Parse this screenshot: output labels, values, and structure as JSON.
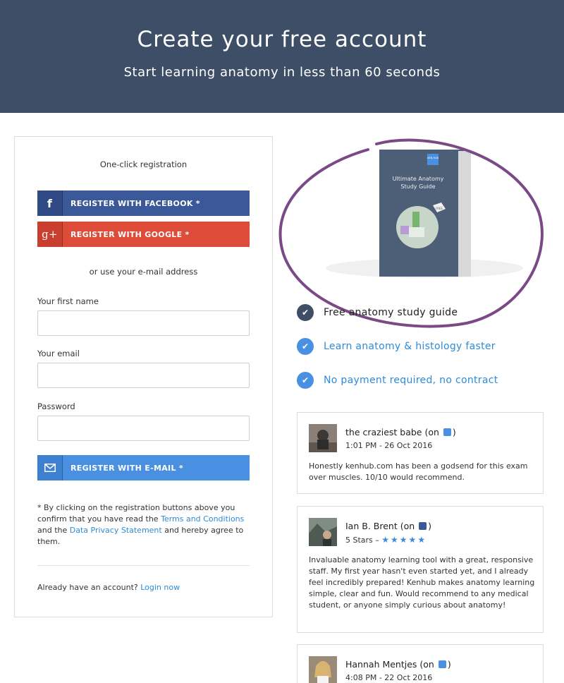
{
  "header": {
    "title": "Create your free account",
    "subtitle": "Start learning anatomy in less than 60 seconds"
  },
  "form": {
    "one_click_label": "One-click registration",
    "facebook_button": "REGISTER WITH FACEBOOK *",
    "google_button": "REGISTER WITH GOOGLE *",
    "or_use_label": "or use your e-mail address",
    "first_name_label": "Your first name",
    "first_name_value": "",
    "email_label": "Your email",
    "email_value": "",
    "password_label": "Password",
    "password_value": "",
    "email_button": "REGISTER WITH E-MAIL *",
    "legal_prefix": "* By clicking on the registration buttons above you confirm that you have read the ",
    "terms_link": "Terms and Conditions",
    "legal_and": " and the ",
    "privacy_link": "Data Privacy Statement",
    "legal_suffix": " and hereby agree to them.",
    "already_text": "Already have an account? ",
    "login_link": "Login now"
  },
  "guide": {
    "book_title_line1": "Ultimate Anatomy",
    "book_title_line2": "Study Guide",
    "brand": "KEN HUB",
    "badge": "FREE"
  },
  "benefits": [
    "Free anatomy study guide",
    "Learn anatomy & histology faster",
    "No payment required, no contract"
  ],
  "reviews": [
    {
      "name": "the craziest babe (on",
      "name_suffix": ")",
      "meta": "1:01 PM - 26 Oct 2016",
      "text": "Honestly kenhub.com has been a godsend for this exam over muscles. 10/10 would recommend."
    },
    {
      "name": "Ian B. Brent (on",
      "name_suffix": ")",
      "meta": "5 Stars – ",
      "rating": 5,
      "stars": "★★★★★",
      "text": "Invaluable anatomy learning tool with a great, responsive staff. My first year hasn't even started yet, and I already feel incredibly prepared! Kenhub makes anatomy learning simple, clear and fun. Would recommend to any medical student, or anyone simply curious about anatomy!"
    },
    {
      "name": "Hannah Mentjes (on",
      "name_suffix": ")",
      "meta": "4:08 PM - 22 Oct 2016"
    }
  ],
  "colors": {
    "header_bg": "#3d4e66",
    "facebook": "#3b5998",
    "google": "#dd4b39",
    "email": "#4a90e2",
    "link": "#2e8bd8",
    "circle": "#7b4a86"
  },
  "icons": {
    "facebook": "f",
    "google": "g+",
    "check": "✔"
  }
}
